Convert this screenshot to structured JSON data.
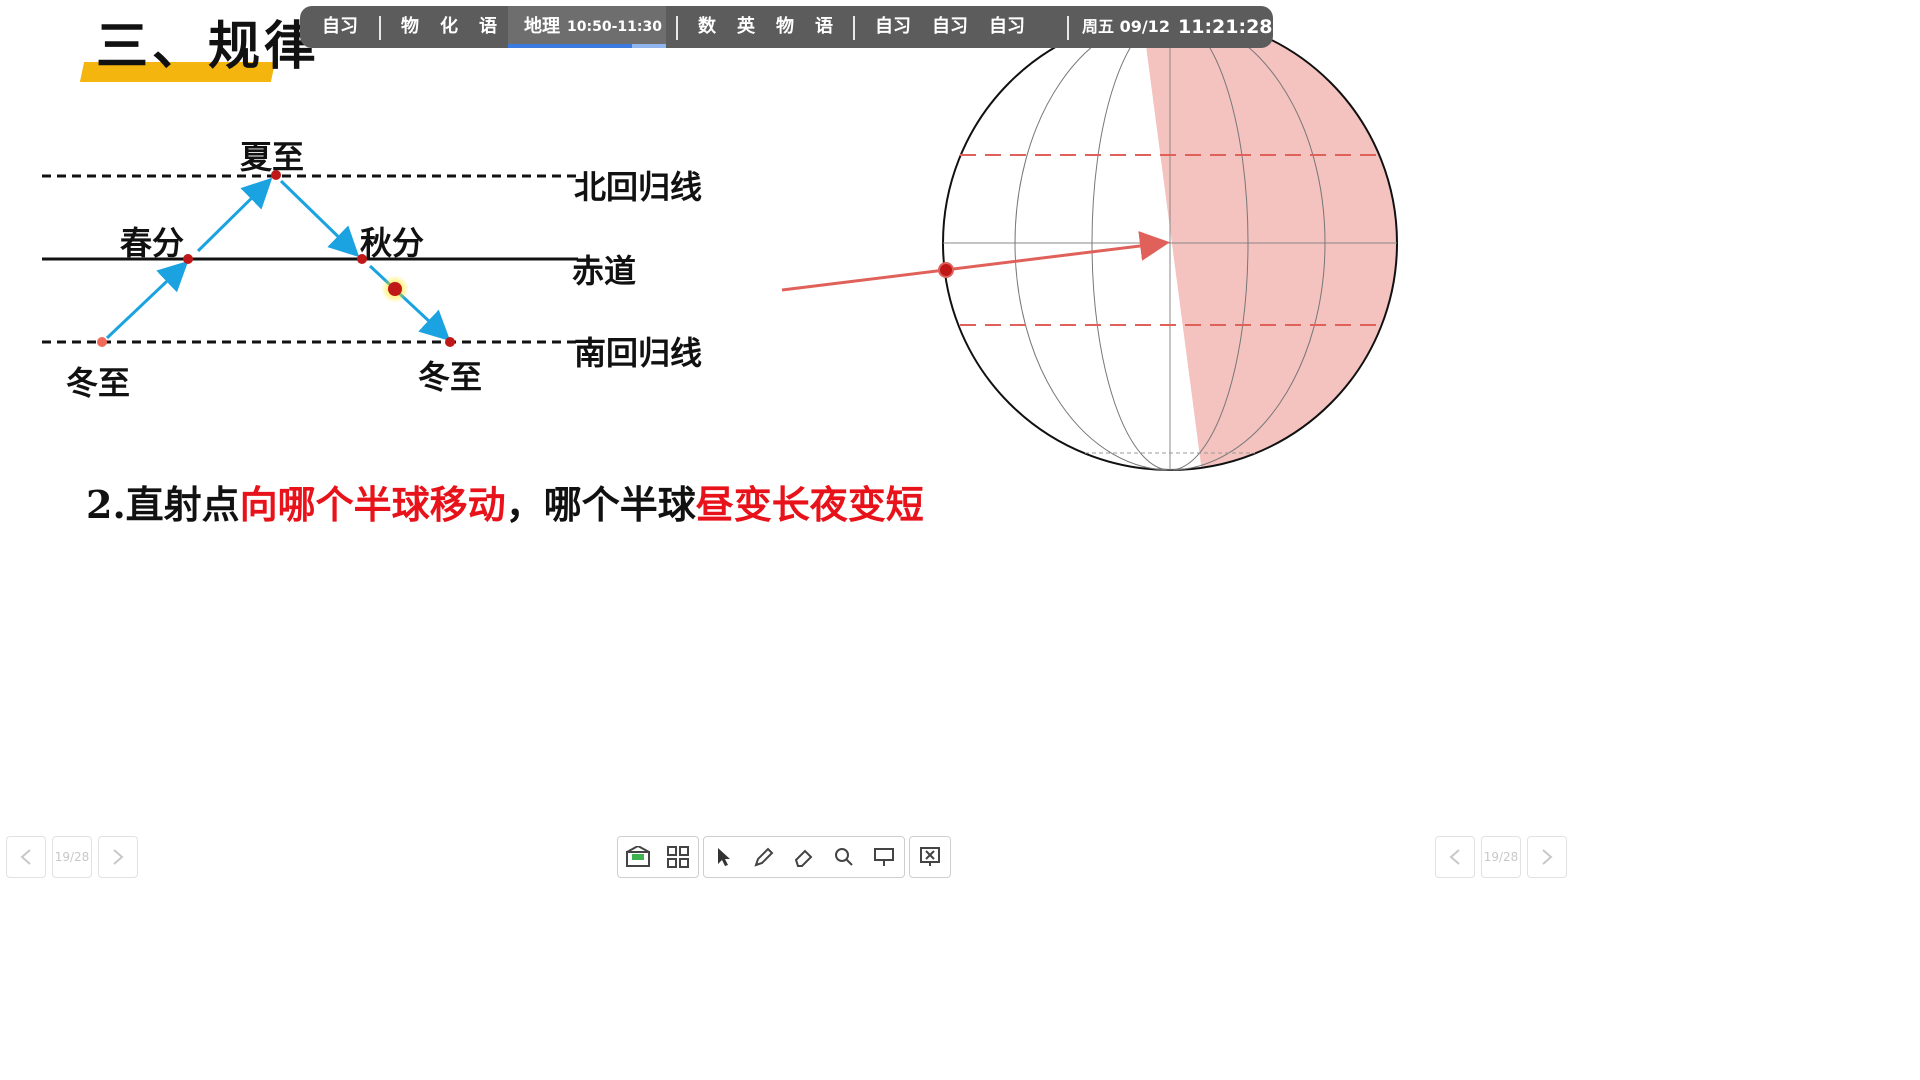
{
  "slide": {
    "title": "三、规律",
    "sentence": {
      "p1": "2.直射点",
      "p2": "向哪个半球移动",
      "p3": "，哪个半球",
      "p4": "昼变长夜变短"
    }
  },
  "diagram": {
    "points": {
      "summer": "夏至",
      "spring": "春分",
      "autumn": "秋分",
      "winter_left": "冬至",
      "winter_right": "冬至"
    },
    "lines": {
      "tropic_north": "北回归线",
      "equator": "赤道",
      "tropic_south": "南回归线"
    }
  },
  "schedule": {
    "items": [
      "自习",
      "物",
      "化",
      "语",
      "地理",
      "10:50-11:30",
      "数",
      "英",
      "物",
      "语",
      "自习",
      "自习",
      "自习"
    ],
    "date": "周五 09/12",
    "time": "11:21:28"
  },
  "pager": {
    "left_page": "19/28",
    "right_page": "19/28"
  },
  "toolbar": {
    "icons": [
      "envelope-icon",
      "grid-icon",
      "pointer-icon",
      "pen-icon",
      "eraser-icon",
      "search-icon",
      "presentation-icon",
      "close-screen-icon"
    ]
  },
  "colors": {
    "accent": "#f5b50f",
    "arrow_blue": "#1aa3e0",
    "text_red": "#e8121a",
    "globe_shade": "#f4c2bf",
    "marker_red": "#c01818"
  }
}
